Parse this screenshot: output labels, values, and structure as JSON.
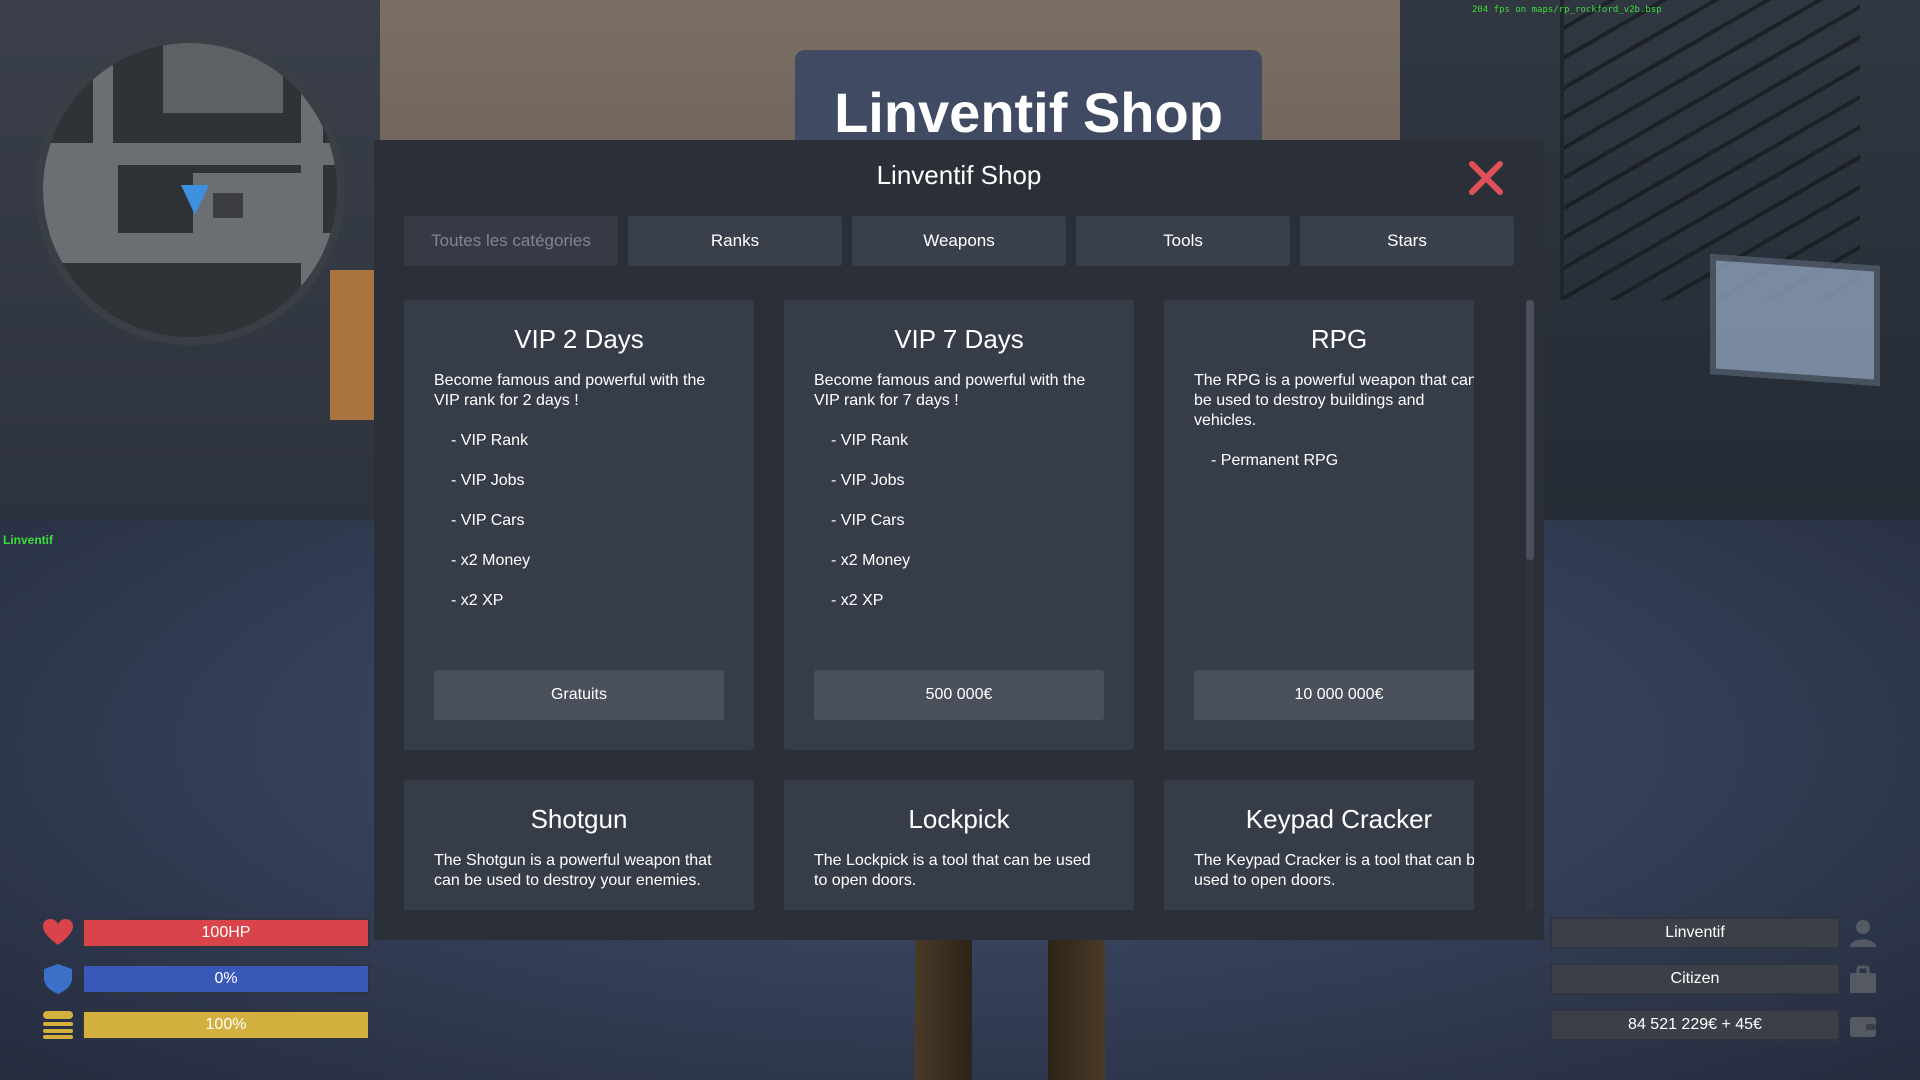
{
  "hud": {
    "fps_text": "204 fps on maps/rp_rockford_v2b.bsp",
    "player_tag": "Linventif",
    "health_label": "100HP",
    "armor_label": "0%",
    "hunger_label": "100%",
    "player_name": "Linventif",
    "job": "Citizen",
    "money": "84 521 229€ + 45€",
    "colors": {
      "health": "#d9434a",
      "armor": "#3a58b8",
      "hunger": "#d4b03e"
    },
    "icons": {
      "health": "heart-icon",
      "armor": "shield-icon",
      "hunger": "burger-icon",
      "name": "person-icon",
      "job": "briefcase-icon",
      "money": "wallet-icon"
    }
  },
  "banner": {
    "title": "Linventif Shop"
  },
  "shop": {
    "title": "Linventif Shop",
    "close_icon": "close-icon",
    "close_color": "#e05058",
    "tabs": [
      {
        "label": "Toutes les catégories",
        "disabled": true
      },
      {
        "label": "Ranks"
      },
      {
        "label": "Weapons"
      },
      {
        "label": "Tools"
      },
      {
        "label": "Stars"
      }
    ],
    "items": [
      {
        "name": "VIP 2 Days",
        "description": "Become famous and powerful with the VIP rank for 2 days !",
        "features": [
          "- VIP Rank",
          "- VIP Jobs",
          "- VIP Cars",
          "- x2 Money",
          "- x2 XP"
        ],
        "price": "Gratuits"
      },
      {
        "name": "VIP 7 Days",
        "description": "Become famous and powerful with the VIP rank for 7 days !",
        "features": [
          "- VIP Rank",
          "- VIP Jobs",
          "- VIP Cars",
          "- x2 Money",
          "- x2 XP"
        ],
        "price": "500 000€"
      },
      {
        "name": "RPG",
        "description": "The RPG is a powerful weapon that can be used to destroy buildings and vehicles.",
        "features": [
          "- Permanent RPG"
        ],
        "price": "10 000 000€"
      },
      {
        "name": "Shotgun",
        "description": "The Shotgun is a powerful weapon that can be used to destroy your enemies."
      },
      {
        "name": "Lockpick",
        "description": "The Lockpick is a tool that can be used to open doors."
      },
      {
        "name": "Keypad Cracker",
        "description": "The Keypad Cracker is a tool that can be used to open doors."
      }
    ]
  }
}
